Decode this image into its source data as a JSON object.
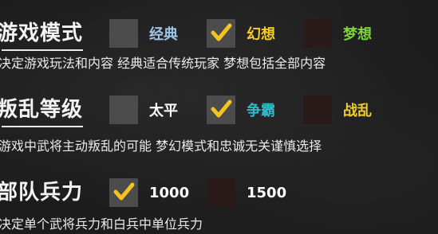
{
  "colors": {
    "blue_label": "#9fc4e6",
    "yellow_label": "#f2cc2e",
    "green_label": "#7fd43a",
    "white_label": "#ffffff",
    "red_label": "#ff3b3b",
    "check_yellow": "#f6c21d",
    "box_gray": "#4c4c4c",
    "box_dark_red": "#2a1a1a"
  },
  "game_mode": {
    "title": "游戏模式",
    "options": [
      {
        "label": "经典",
        "checked": false,
        "color": "#9fc4e6"
      },
      {
        "label": "幻想",
        "checked": true,
        "color": "#f2cc2e"
      },
      {
        "label": "梦想",
        "checked": false,
        "color": "#7fd43a"
      }
    ],
    "description": "决定游戏玩法和内容 经典适合传统玩家 梦想包括全部内容"
  },
  "rebellion_level": {
    "title": "叛乱等级",
    "options": [
      {
        "label": "太平",
        "checked": false,
        "color": "#ffffff"
      },
      {
        "label": "争霸",
        "checked": true,
        "color": "#30b8c8"
      },
      {
        "label": "战乱",
        "checked": false,
        "color": "#f2cc2e"
      }
    ],
    "description": "游戏中武将主动叛乱的可能 梦幻模式和忠诚无关谨慎选择"
  },
  "troop_strength": {
    "title": "部队兵力",
    "options": [
      {
        "label": "1000",
        "checked": true,
        "color": "#ffffff"
      },
      {
        "label": "1500",
        "checked": false,
        "color": "#ffffff"
      }
    ],
    "description": "决定单个武将兵力和白兵中单位兵力"
  }
}
